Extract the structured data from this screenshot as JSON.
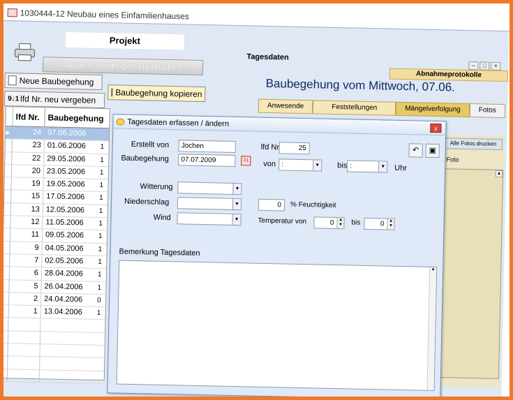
{
  "window": {
    "title": "1030444-12 Neubau eines Einfamilienhauses"
  },
  "toolbar": {
    "projekt_tab": "Projekt",
    "print_button": "Aktuelle Baubegehung drucken",
    "neu_button": "Neue Baubegehung",
    "kopieren_button": "Baubegehung kopieren",
    "lfd_button": "lfd Nr. neu vergeben",
    "sort_glyph": "9↓1"
  },
  "tabs": {
    "tagesdaten": "Tagesdaten",
    "abnahmeprotokolle": "Abnahmeprotokolle",
    "subtabs": [
      "Anwesende",
      "Feststellungen",
      "Mängelverfolgung",
      "Fotos"
    ]
  },
  "header": {
    "title": "Baubegehung vom Mittwoch, 07.06."
  },
  "right_panel": {
    "button": "Alle Fotos drucken",
    "column": "Foto"
  },
  "grid": {
    "col_lfd": "lfd Nr.",
    "col_date": "Baubegehung",
    "rows": [
      {
        "lfd": "24",
        "date": "07.06.2006",
        "extra": "",
        "selected": true
      },
      {
        "lfd": "23",
        "date": "01.06.2006",
        "extra": "1"
      },
      {
        "lfd": "22",
        "date": "29.05.2006",
        "extra": "1"
      },
      {
        "lfd": "20",
        "date": "23.05.2006",
        "extra": "1"
      },
      {
        "lfd": "19",
        "date": "19.05.2006",
        "extra": "1"
      },
      {
        "lfd": "15",
        "date": "17.05.2006",
        "extra": "1"
      },
      {
        "lfd": "13",
        "date": "12.05.2006",
        "extra": "1"
      },
      {
        "lfd": "12",
        "date": "11.05.2006",
        "extra": "1"
      },
      {
        "lfd": "11",
        "date": "09.05.2006",
        "extra": "1"
      },
      {
        "lfd": "9",
        "date": "04.05.2006",
        "extra": "1"
      },
      {
        "lfd": "7",
        "date": "02.05.2006",
        "extra": "1"
      },
      {
        "lfd": "6",
        "date": "28.04.2006",
        "extra": "1"
      },
      {
        "lfd": "5",
        "date": "26.04.2006",
        "extra": "1"
      },
      {
        "lfd": "2",
        "date": "24.04.2006",
        "extra": "0"
      },
      {
        "lfd": "1",
        "date": "13.04.2006",
        "extra": "1"
      },
      {
        "lfd": "",
        "date": "",
        "extra": ""
      },
      {
        "lfd": "",
        "date": "",
        "extra": ""
      },
      {
        "lfd": "",
        "date": "",
        "extra": ""
      },
      {
        "lfd": "",
        "date": "",
        "extra": ""
      },
      {
        "lfd": "",
        "date": "",
        "extra": ""
      }
    ]
  },
  "dialog": {
    "title": "Tagesdaten erfassen / ändern",
    "close": "x",
    "erstellt_label": "Erstellt von",
    "erstellt_value": "Jochen",
    "baubegehung_label": "Baubegehung",
    "baubegehung_value": "07.07.2009",
    "lfd_label": "lfd Nr",
    "lfd_value": "25",
    "von_label": "von",
    "von_value": ":",
    "bis_label": "bis",
    "bis_value": ":",
    "uhr_label": "Uhr",
    "witterung_label": "Witterung",
    "niederschlag_label": "Niederschlag",
    "wind_label": "Wind",
    "feuchtigkeit_value": "0",
    "feuchtigkeit_label": "% Feuchtigkeit",
    "temperatur_label": "Temperatur von",
    "temp_von_value": "0",
    "temp_bis_label": "bis",
    "temp_bis_value": "0",
    "bemerkung_label": "Bemerkung Tagesdaten",
    "bemerkung_value": "",
    "cal_glyph": "31",
    "undo_glyph": "↶",
    "save_glyph": "▣"
  },
  "icons": {
    "printer": "printer-icon",
    "dropdown": "▼",
    "spin_up": "▲",
    "spin_down": "▼"
  }
}
